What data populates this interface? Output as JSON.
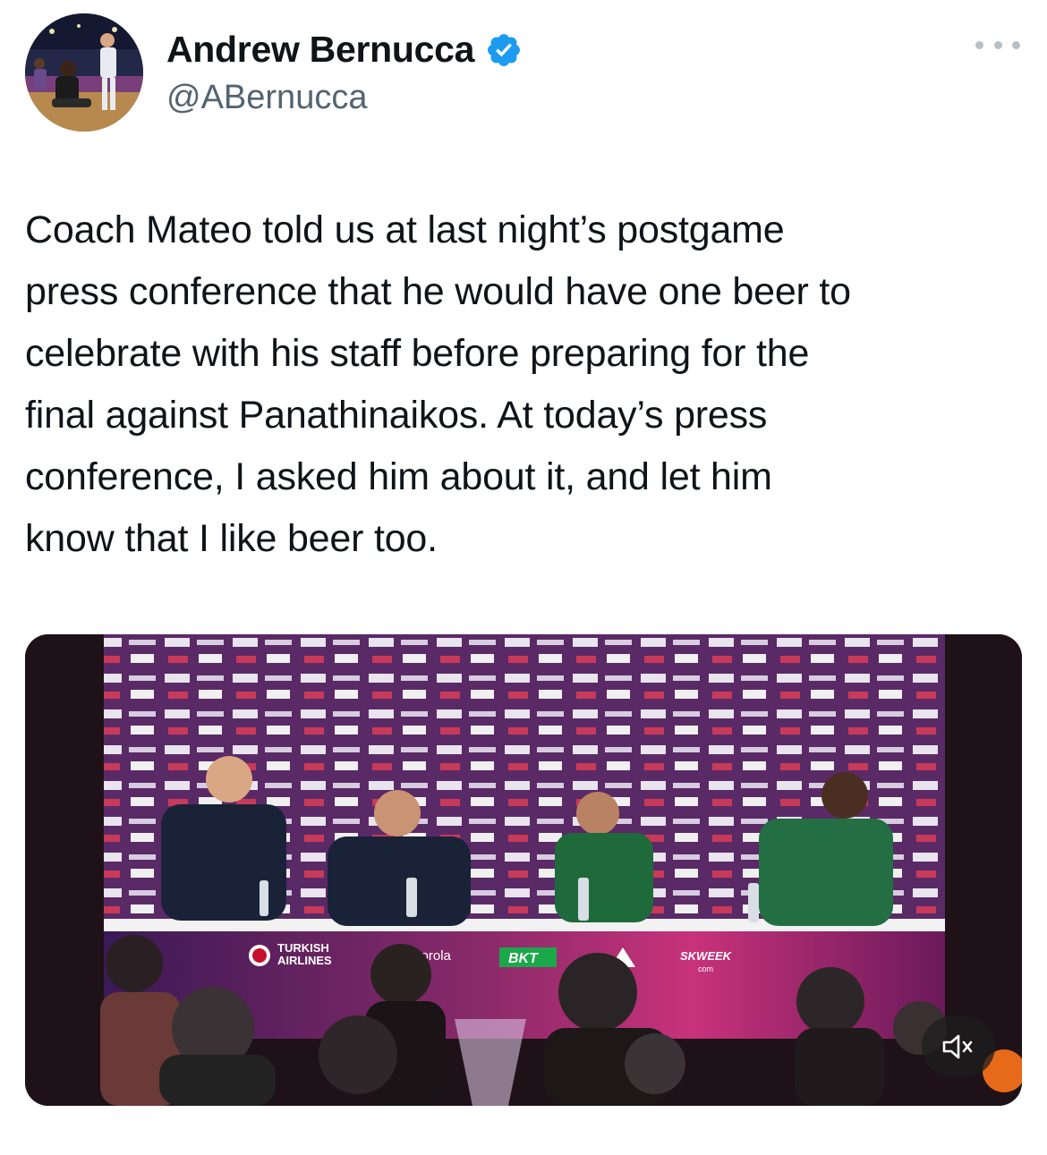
{
  "author": {
    "name": "Andrew Bernucca",
    "handle": "@ABernucca",
    "verified": true,
    "verified_color": "#1d9bf0"
  },
  "icons": {
    "avatar": "profile-photo",
    "verified": "verified-badge-icon",
    "more": "more-options-icon",
    "mute": "volume-muted-icon"
  },
  "tweet": {
    "lines": [
      "Coach Mateo told us at last night’s postgame",
      "press conference that he would have one beer to",
      "celebrate with his staff before preparing for the",
      "final against Panathinaikos. At today’s press",
      "conference, I asked him about it, and let him",
      "know that I like beer too."
    ]
  },
  "media": {
    "type": "video",
    "muted": true,
    "sponsor_texts": [
      "TURKISH",
      "AIRLINES",
      "otorola",
      "BKT",
      "SKWEEK",
      "com"
    ]
  }
}
